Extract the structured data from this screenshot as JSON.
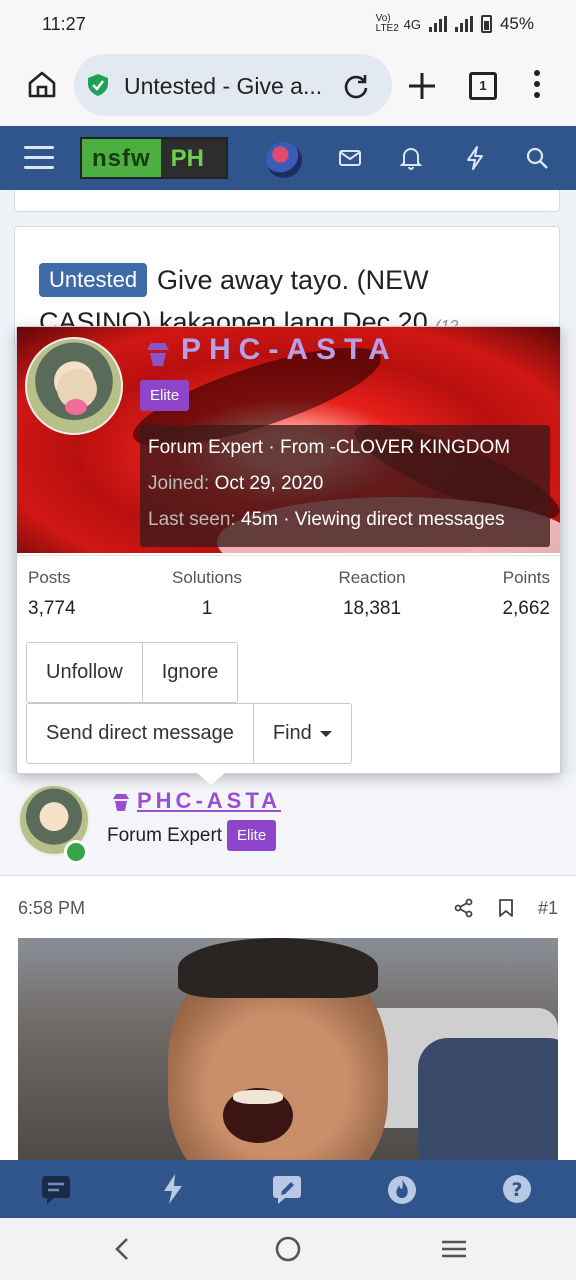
{
  "status_bar": {
    "time": "11:27",
    "network_label": "Vo) LTE2",
    "network_type": "4G",
    "battery": "45%"
  },
  "browser": {
    "tab_title": "Untested - Give a...",
    "tab_count": "1"
  },
  "forum_nav": {
    "logo_left": "nsfw",
    "logo_right": "PH",
    "colors": {
      "nav_bg": "#2f558c",
      "logo_green": "#4caf3f"
    }
  },
  "thread": {
    "prefix": "Untested",
    "title_line1": "Give away tayo. (NEW",
    "title_line2": "CASINO) kakaopen lang Dec 20",
    "title_suffix": "(12"
  },
  "profile_popup": {
    "username": "PHC-ASTA",
    "badge": "Elite",
    "title": "Forum Expert",
    "separator": "·",
    "from_label": "From",
    "location": "-CLOVER KINGDOM",
    "joined_label": "Joined:",
    "joined_date": "Oct 29, 2020",
    "last_seen_label": "Last seen:",
    "last_seen_value": "45m · Viewing direct messages",
    "stats": [
      {
        "label": "Posts",
        "value": "3,774"
      },
      {
        "label": "Solutions",
        "value": "1"
      },
      {
        "label": "Reaction",
        "value": "18,381"
      },
      {
        "label": "Points",
        "value": "2,662"
      }
    ],
    "buttons": {
      "unfollow": "Unfollow",
      "ignore": "Ignore",
      "send_dm": "Send direct message",
      "find": "Find"
    },
    "colors": {
      "name": "#b79fe9",
      "badge": "#8f45c9"
    }
  },
  "post": {
    "username": "PHC-ASTA",
    "user_title": "Forum Expert",
    "badge": "Elite",
    "time": "6:58 PM",
    "post_number": "#1"
  },
  "bottom_tabs": [
    "chat-icon",
    "bolt-icon",
    "edit-icon",
    "fire-icon",
    "help-icon"
  ]
}
